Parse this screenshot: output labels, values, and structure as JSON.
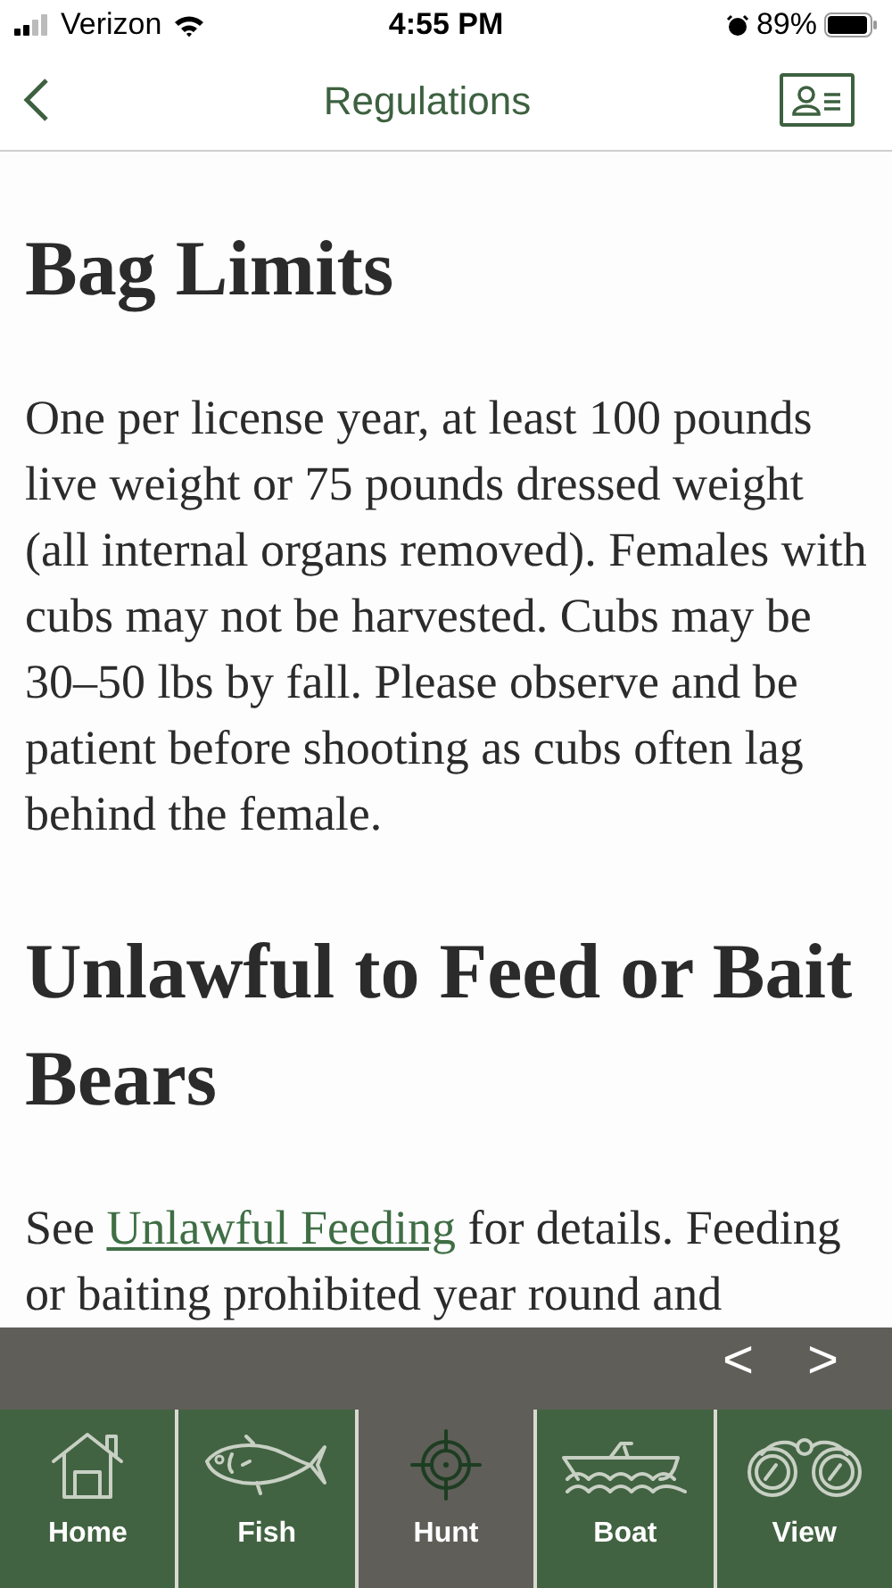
{
  "status_bar": {
    "carrier": "Verizon",
    "time": "4:55 PM",
    "battery": "89%"
  },
  "header": {
    "title": "Regulations"
  },
  "sections": [
    {
      "heading": "Bag Limits",
      "body": {
        "before": "One per license year, at least 100 pounds live weight or 75 pounds dressed weight (all internal organs removed). Females with cubs may not be harvested. Cubs may be 30–50 lbs by fall. Please observe and be patient before shooting as cubs often lag behind the female."
      }
    },
    {
      "heading": "Unlawful to Feed or Bait Bears",
      "body": {
        "before": "See ",
        "link": "Unlawful Feeding",
        "after": " for details. Feeding or baiting prohibited year round and"
      }
    }
  ],
  "pager": {
    "prev": "<",
    "next": ">"
  },
  "tabs": [
    {
      "label": "Home",
      "kind": "home",
      "selected": false
    },
    {
      "label": "Fish",
      "kind": "fish",
      "selected": false
    },
    {
      "label": "Hunt",
      "kind": "hunt",
      "selected": true
    },
    {
      "label": "Boat",
      "kind": "boat",
      "selected": false
    },
    {
      "label": "View",
      "kind": "view",
      "selected": false
    }
  ]
}
